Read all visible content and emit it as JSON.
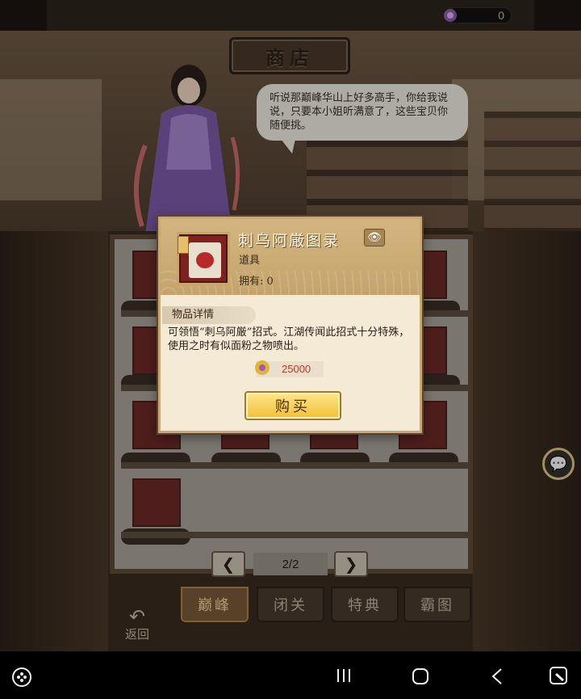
{
  "topbar": {
    "currency_value": "0"
  },
  "scene": {
    "title": "商店",
    "speech": "听说那巅峰华山上好多高手，你给我说说，只要本小姐听满意了，这些宝贝你随便挑。"
  },
  "dialog": {
    "item_name": "刺乌阿厳图录",
    "item_type": "道具",
    "owned_label": "拥有",
    "owned_value": "0",
    "detail_tab": "物品详情",
    "description": "可领悟“刺乌阿厳”招式。江湖传闻此招式十分特殊，使用之时有似面粉之物喷出。",
    "price": "25000",
    "buy_label": "购买"
  },
  "pager": {
    "prev": "❮",
    "page": "2/2",
    "next": "❯"
  },
  "tabs": [
    {
      "label": "巅峰",
      "active": true
    },
    {
      "label": "闭关",
      "active": false
    },
    {
      "label": "特典",
      "active": false
    },
    {
      "label": "霸图",
      "active": false
    }
  ],
  "back_label": "返回",
  "icons": {
    "eye": "eye-icon",
    "coin": "coin-icon",
    "chat": "chat-icon",
    "gamepad": "gamepad-icon",
    "recents": "recents-icon",
    "home": "home-icon",
    "back": "back-icon",
    "screen": "screen-icon"
  },
  "colors": {
    "accent_gold": "#f2bf3a",
    "price_red": "#b83a2a",
    "dialog_bg": "#f4ead6"
  }
}
